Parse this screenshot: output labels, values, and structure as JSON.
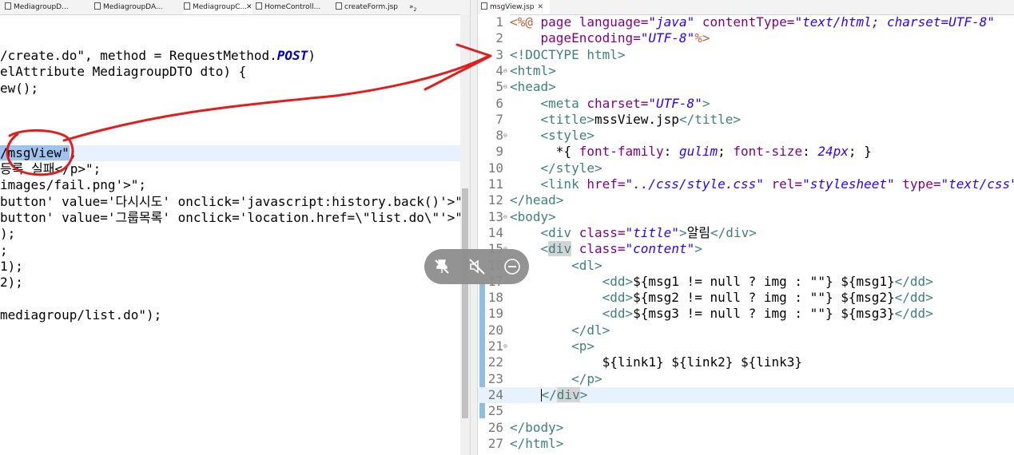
{
  "left_editor": {
    "tabs": [
      {
        "label": "MediagroupD..."
      },
      {
        "label": "MediagroupDA..."
      },
      {
        "label": "MediagroupC..."
      },
      {
        "label": "HomeControll..."
      },
      {
        "label": "createForm.jsp"
      }
    ],
    "overflow_label": "»",
    "overflow_count": "2",
    "lines": [
      {
        "parts": [
          {
            "t": "/create.do\", method = RequestMethod.",
            "c": ""
          },
          {
            "t": "POST",
            "c": "ital"
          },
          {
            "t": ")",
            "c": ""
          }
        ]
      },
      {
        "parts": [
          {
            "t": "elAttribute MediagroupDTO dto) {",
            "c": ""
          }
        ]
      },
      {
        "parts": [
          {
            "t": "ew();",
            "c": ""
          }
        ]
      },
      {
        "parts": [
          {
            "t": "",
            "c": ""
          }
        ]
      },
      {
        "parts": [
          {
            "t": "",
            "c": ""
          }
        ]
      },
      {
        "parts": [
          {
            "t": "",
            "c": ""
          }
        ]
      },
      {
        "parts": [
          {
            "t": "/msgView\"",
            "c": "sel"
          },
          {
            "t": ";",
            "c": ""
          }
        ]
      },
      {
        "parts": [
          {
            "t": "등록 실패</p>\";",
            "c": ""
          }
        ]
      },
      {
        "parts": [
          {
            "t": "images/fail.png'>\";",
            "c": ""
          }
        ]
      },
      {
        "parts": [
          {
            "t": "button' value='다시시도' onclick='javascript:history.back()'>\";",
            "c": ""
          }
        ]
      },
      {
        "parts": [
          {
            "t": "button' value='그룹목록' onclick='location.href=\\\"list.do\\\"'>\";",
            "c": ""
          }
        ]
      },
      {
        "parts": [
          {
            "t": ");",
            "c": ""
          }
        ]
      },
      {
        "parts": [
          {
            "t": ";",
            "c": ""
          }
        ]
      },
      {
        "parts": [
          {
            "t": "1);",
            "c": ""
          }
        ]
      },
      {
        "parts": [
          {
            "t": "2);",
            "c": ""
          }
        ]
      },
      {
        "parts": [
          {
            "t": "",
            "c": ""
          }
        ]
      },
      {
        "parts": [
          {
            "t": "mediagroup/list.do\");",
            "c": ""
          }
        ]
      }
    ]
  },
  "right_editor": {
    "tab_label": "msgView.jsp",
    "close_glyph": "✕",
    "lines": [
      {
        "n": "1",
        "f": "",
        "parts": [
          {
            "t": "<%@",
            "c": "jsp"
          },
          {
            "t": " page ",
            "c": "attr"
          },
          {
            "t": "language=",
            "c": "attr"
          },
          {
            "t": "\"java\"",
            "c": "aval"
          },
          {
            "t": " contentType=",
            "c": "attr"
          },
          {
            "t": "\"text/html; charset=UTF-8\"",
            "c": "aval"
          }
        ]
      },
      {
        "n": "2",
        "f": "",
        "parts": [
          {
            "t": "    pageEncoding=",
            "c": "attr"
          },
          {
            "t": "\"UTF-8\"",
            "c": "aval"
          },
          {
            "t": "%>",
            "c": "jsp"
          }
        ]
      },
      {
        "n": "3",
        "f": "",
        "parts": [
          {
            "t": "<!DOCTYPE html>",
            "c": "tag"
          }
        ]
      },
      {
        "n": "4",
        "f": "⊖",
        "parts": [
          {
            "t": "<html>",
            "c": "tag"
          }
        ]
      },
      {
        "n": "5",
        "f": "⊖",
        "parts": [
          {
            "t": "<head>",
            "c": "tag"
          }
        ]
      },
      {
        "n": "6",
        "f": "",
        "parts": [
          {
            "t": "    <meta ",
            "c": "tag"
          },
          {
            "t": "charset=",
            "c": "attr"
          },
          {
            "t": "\"UTF-8\"",
            "c": "aval"
          },
          {
            "t": ">",
            "c": "tag"
          }
        ]
      },
      {
        "n": "7",
        "f": "",
        "parts": [
          {
            "t": "    <title>",
            "c": "tag"
          },
          {
            "t": "mssView.jsp",
            "c": ""
          },
          {
            "t": "</title>",
            "c": "tag"
          }
        ]
      },
      {
        "n": "8",
        "f": "⊖",
        "parts": [
          {
            "t": "    <style>",
            "c": "tag"
          }
        ]
      },
      {
        "n": "9",
        "f": "",
        "parts": [
          {
            "t": "      *{ ",
            "c": ""
          },
          {
            "t": "font-family",
            "c": "cssprop"
          },
          {
            "t": ": ",
            "c": ""
          },
          {
            "t": "gulim",
            "c": "cssval"
          },
          {
            "t": "; ",
            "c": ""
          },
          {
            "t": "font-size",
            "c": "cssprop"
          },
          {
            "t": ": ",
            "c": ""
          },
          {
            "t": "24px",
            "c": "cssval"
          },
          {
            "t": "; }",
            "c": ""
          }
        ]
      },
      {
        "n": "10",
        "f": "",
        "parts": [
          {
            "t": "    </style>",
            "c": "tag"
          }
        ]
      },
      {
        "n": "11",
        "f": "",
        "parts": [
          {
            "t": "    <link ",
            "c": "tag"
          },
          {
            "t": "href=",
            "c": "attr"
          },
          {
            "t": "\"../css/style.css\"",
            "c": "aval"
          },
          {
            "t": " rel=",
            "c": "attr"
          },
          {
            "t": "\"stylesheet\"",
            "c": "aval"
          },
          {
            "t": " type=",
            "c": "attr"
          },
          {
            "t": "\"text/css\"",
            "c": "aval"
          },
          {
            "t": ">",
            "c": "tag"
          }
        ]
      },
      {
        "n": "12",
        "f": "",
        "parts": [
          {
            "t": "</head>",
            "c": "tag"
          }
        ]
      },
      {
        "n": "13",
        "f": "⊖",
        "parts": [
          {
            "t": "<body>",
            "c": "tag"
          }
        ]
      },
      {
        "n": "14",
        "f": "",
        "parts": [
          {
            "t": "    <div ",
            "c": "tag"
          },
          {
            "t": "class=",
            "c": "attr"
          },
          {
            "t": "\"title\"",
            "c": "aval"
          },
          {
            "t": ">",
            "c": "tag"
          },
          {
            "t": "알림",
            "c": ""
          },
          {
            "t": "</div>",
            "c": "tag"
          }
        ]
      },
      {
        "n": "15",
        "f": "⊖",
        "parts": [
          {
            "t": "    <",
            "c": "tag"
          },
          {
            "t": "div",
            "c": "tag matchbox"
          },
          {
            "t": " ",
            "c": ""
          },
          {
            "t": "class=",
            "c": "attr"
          },
          {
            "t": "\"content\"",
            "c": "aval"
          },
          {
            "t": ">",
            "c": "tag"
          }
        ]
      },
      {
        "n": "16",
        "f": "⊖",
        "parts": [
          {
            "t": "        <dl>",
            "c": "tag"
          }
        ]
      },
      {
        "n": "17",
        "f": "",
        "parts": [
          {
            "t": "            <dd>",
            "c": "tag"
          },
          {
            "t": "${msg1 != null ? img : \"\"} ${msg1}",
            "c": ""
          },
          {
            "t": "</dd>",
            "c": "tag"
          }
        ]
      },
      {
        "n": "18",
        "f": "",
        "parts": [
          {
            "t": "            <dd>",
            "c": "tag"
          },
          {
            "t": "${msg2 != null ? img : \"\"} ${msg2}",
            "c": ""
          },
          {
            "t": "</dd>",
            "c": "tag"
          }
        ]
      },
      {
        "n": "19",
        "f": "",
        "parts": [
          {
            "t": "            <dd>",
            "c": "tag"
          },
          {
            "t": "${msg3 != null ? img : \"\"} ${msg3}",
            "c": ""
          },
          {
            "t": "</dd>",
            "c": "tag"
          }
        ]
      },
      {
        "n": "20",
        "f": "",
        "parts": [
          {
            "t": "        </dl>",
            "c": "tag"
          }
        ]
      },
      {
        "n": "21",
        "f": "⊖",
        "parts": [
          {
            "t": "        <p>",
            "c": "tag"
          }
        ]
      },
      {
        "n": "22",
        "f": "",
        "parts": [
          {
            "t": "            ${link1} ${link2} ${link3}",
            "c": ""
          }
        ]
      },
      {
        "n": "23",
        "f": "",
        "parts": [
          {
            "t": "        </p>",
            "c": "tag"
          }
        ]
      },
      {
        "n": "24",
        "f": "",
        "parts": [
          {
            "t": "    ",
            "c": ""
          },
          {
            "t": "CURSOR",
            "c": "cursor"
          },
          {
            "t": "</",
            "c": "tag"
          },
          {
            "t": "div",
            "c": "tag matchbox"
          },
          {
            "t": ">",
            "c": "tag"
          }
        ]
      },
      {
        "n": "25",
        "f": "",
        "parts": [
          {
            "t": "",
            "c": ""
          }
        ]
      },
      {
        "n": "26",
        "f": "",
        "parts": [
          {
            "t": "</body>",
            "c": "tag"
          }
        ]
      },
      {
        "n": "27",
        "f": "",
        "parts": [
          {
            "t": "</html>",
            "c": "tag"
          }
        ]
      }
    ]
  },
  "floating_toolbar": {
    "icons": [
      "pin-off-icon",
      "mute-icon",
      "minimize-icon"
    ],
    "glyphs": [
      "✕",
      "✕",
      "⊖"
    ]
  },
  "colors": {
    "annotation": "#e01e1e",
    "line_highlight": "#e8f2fe",
    "selection": "#9fc3ef"
  }
}
